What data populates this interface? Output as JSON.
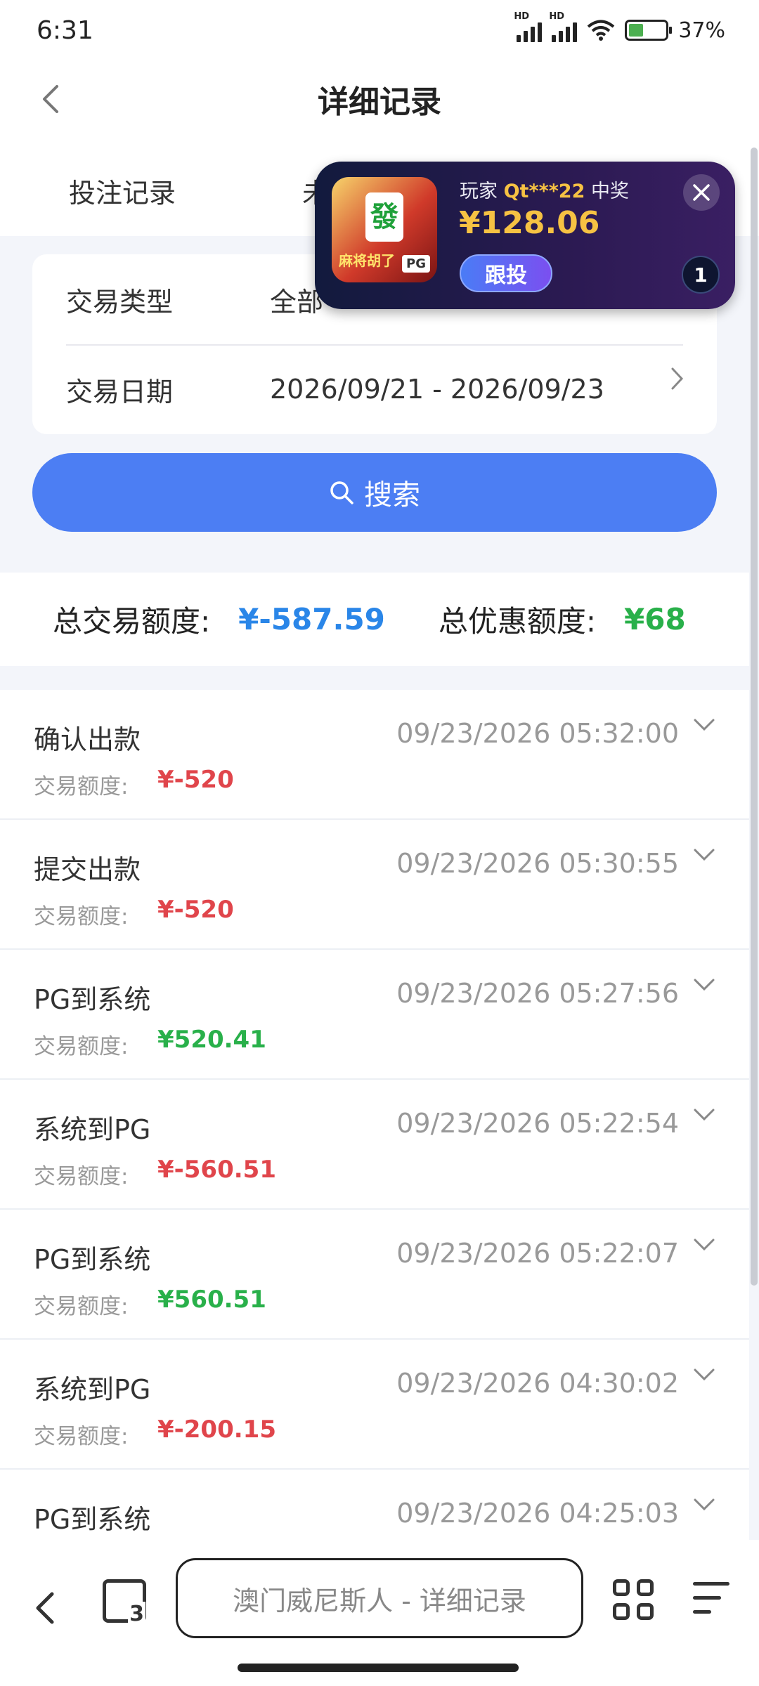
{
  "status": {
    "time": "6:31",
    "battery": "37%"
  },
  "header": {
    "title": "详细记录"
  },
  "tabs": [
    "投注记录",
    "未"
  ],
  "popup": {
    "game_logo_text": "麻将胡了",
    "player_prefix": "玩家",
    "player_name": "Qt***22",
    "player_suffix": "中奖",
    "amount": "¥128.06",
    "follow_label": "跟投",
    "count": "1"
  },
  "filters": {
    "type_label": "交易类型",
    "type_value": "全部",
    "date_label": "交易日期",
    "date_value": "2026/09/21 - 2026/09/23"
  },
  "search": {
    "label": "搜索"
  },
  "summary": {
    "total_label": "总交易额度:",
    "total_value": "¥-587.59",
    "discount_label": "总优惠额度:",
    "discount_value": "¥68"
  },
  "records": [
    {
      "title": "确认出款",
      "time": "09/23/2026 05:32:00",
      "amount_label": "交易额度:",
      "amount": "¥-520",
      "sign": "neg"
    },
    {
      "title": "提交出款",
      "time": "09/23/2026 05:30:55",
      "amount_label": "交易额度:",
      "amount": "¥-520",
      "sign": "neg"
    },
    {
      "title": "PG到系统",
      "time": "09/23/2026 05:27:56",
      "amount_label": "交易额度:",
      "amount": "¥520.41",
      "sign": "pos"
    },
    {
      "title": "系统到PG",
      "time": "09/23/2026 05:22:54",
      "amount_label": "交易额度:",
      "amount": "¥-560.51",
      "sign": "neg"
    },
    {
      "title": "PG到系统",
      "time": "09/23/2026 05:22:07",
      "amount_label": "交易额度:",
      "amount": "¥560.51",
      "sign": "pos"
    },
    {
      "title": "系统到PG",
      "time": "09/23/2026 04:30:02",
      "amount_label": "交易额度:",
      "amount": "¥-200.15",
      "sign": "neg"
    },
    {
      "title": "PG到系统",
      "time": "09/23/2026 04:25:03",
      "amount_label": "",
      "amount": "",
      "sign": "pos"
    }
  ],
  "browser": {
    "address_text": "澳门威尼斯人 - 详细记录",
    "tab_count": "3"
  },
  "colors": {
    "accent": "#4c7ef3",
    "negative": "#e0454b",
    "positive": "#29b04a",
    "total": "#2a86e8",
    "popup_gold": "#f6c243"
  }
}
